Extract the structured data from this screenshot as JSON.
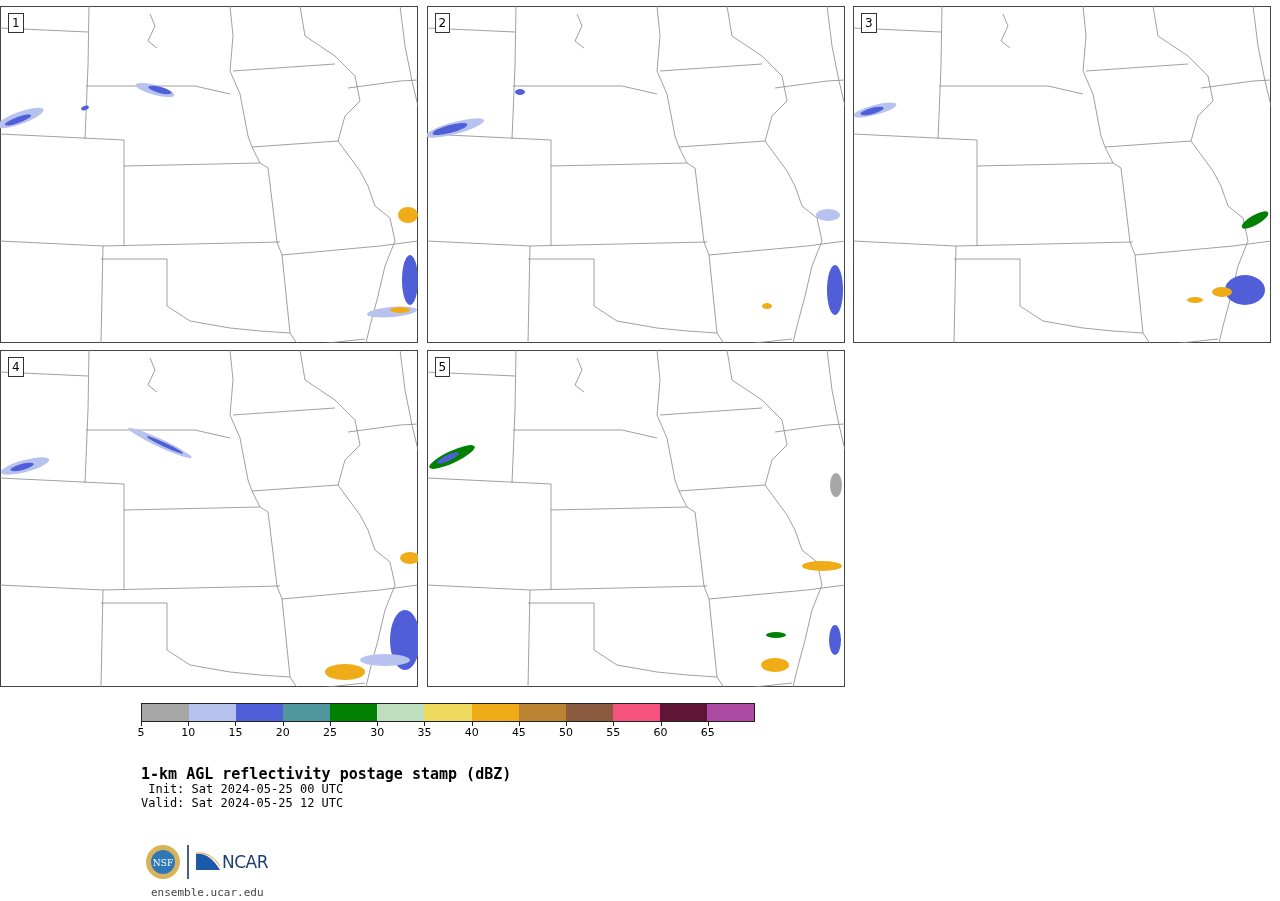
{
  "panels": [
    {
      "label": "1"
    },
    {
      "label": "2"
    },
    {
      "label": "3"
    },
    {
      "label": "4"
    },
    {
      "label": "5"
    }
  ],
  "colorbar": {
    "bins": [
      {
        "label": "5",
        "color": "#a6a6a6"
      },
      {
        "label": "10",
        "color": "#b7c3ee"
      },
      {
        "label": "15",
        "color": "#505ed8"
      },
      {
        "label": "20",
        "color": "#4f969d"
      },
      {
        "label": "25",
        "color": "#018001"
      },
      {
        "label": "30",
        "color": "#bfdfbe"
      },
      {
        "label": "35",
        "color": "#efd95f"
      },
      {
        "label": "40",
        "color": "#efac17"
      },
      {
        "label": "45",
        "color": "#b98331"
      },
      {
        "label": "50",
        "color": "#8b5a3f"
      },
      {
        "label": "55",
        "color": "#f55280"
      },
      {
        "label": "60",
        "color": "#5f1635"
      },
      {
        "label": "65",
        "color": "#ad4aa3"
      }
    ]
  },
  "title": "1-km AGL reflectivity postage stamp (dBZ)",
  "init": " Init: Sat 2024-05-25 00 UTC",
  "valid": "Valid: Sat 2024-05-25 12 UTC",
  "logos": {
    "nsf": "NSF",
    "ncar": "NCAR"
  },
  "url": "ensemble.ucar.edu"
}
